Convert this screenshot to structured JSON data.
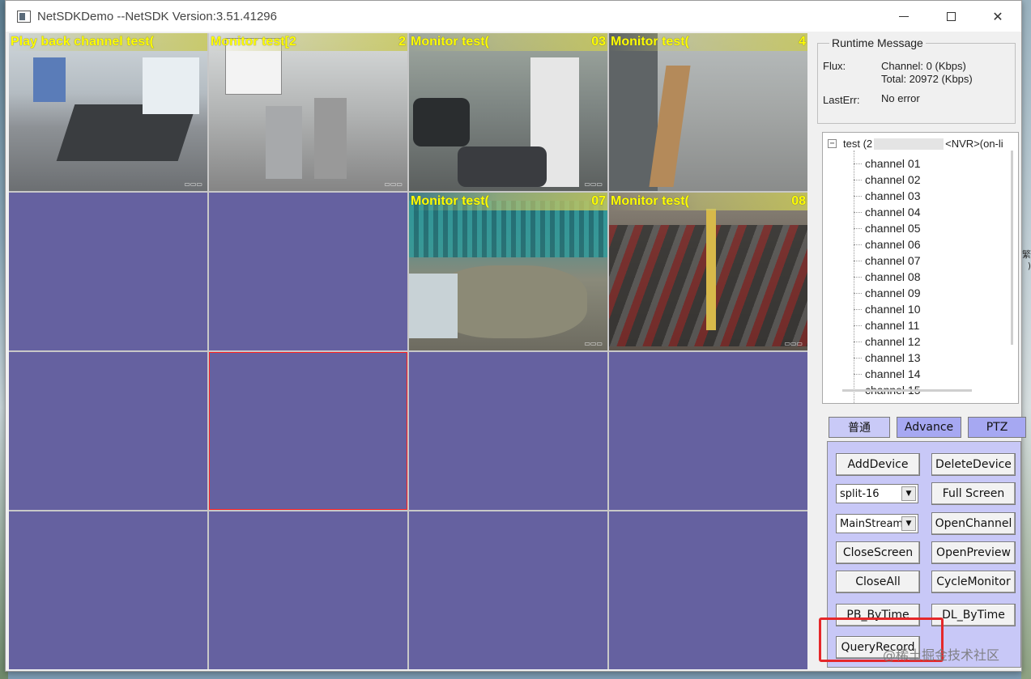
{
  "window": {
    "title": "NetSDKDemo  --NetSDK Version:3.51.41296",
    "minimize": "—",
    "close": "✕"
  },
  "video_cells": [
    {
      "label": "Play back channel test(",
      "num": "",
      "scene": "conference-room"
    },
    {
      "label": "Monitor test[2",
      "num": "2",
      "scene": "turnstile-gate"
    },
    {
      "label": "Monitor test(",
      "num": "03",
      "scene": "parking-lot"
    },
    {
      "label": "Monitor test(",
      "num": "4",
      "scene": "roadway"
    },
    {
      "label": "",
      "num": "",
      "scene": "empty"
    },
    {
      "label": "",
      "num": "",
      "scene": "empty"
    },
    {
      "label": "Monitor test(",
      "num": "07",
      "scene": "construction-site"
    },
    {
      "label": "Monitor test(",
      "num": "08",
      "scene": "bike-shed"
    }
  ],
  "runtime": {
    "group_title": "Runtime Message",
    "flux_label": "Flux:",
    "flux_channel": "Channel: 0 (Kbps)",
    "flux_total": "Total: 20972 (Kbps)",
    "lasterr_label": "LastErr:",
    "lasterr_value": "No error"
  },
  "tree": {
    "root_prefix": "test (2",
    "root_suffix": "<NVR>(on-li",
    "toggle": "−",
    "channels": [
      "channel 01",
      "channel 02",
      "channel 03",
      "channel 04",
      "channel 05",
      "channel 06",
      "channel 07",
      "channel 08",
      "channel 09",
      "channel 10",
      "channel 11",
      "channel 12",
      "channel 13",
      "channel 14",
      "channel 15"
    ]
  },
  "tabs": {
    "normal": "普通",
    "advance": "Advance",
    "ptz": "PTZ"
  },
  "buttons": {
    "add_device": "AddDevice",
    "delete_device": "DeleteDevice",
    "full_screen": "Full Screen",
    "open_channel": "OpenChannel",
    "close_screen": "CloseScreen",
    "open_preview": "OpenPreview",
    "close_all": "CloseAll",
    "cycle_monitor": "CycleMonitor",
    "pb_bytime": "PB_ByTime",
    "dl_bytime": "DL_ByTime",
    "query_record": "QueryRecord"
  },
  "combos": {
    "split": "split-16",
    "stream": "MainStream"
  },
  "watermark": "@稀土掘金技术社区",
  "desktop_glyph": "繁\n)",
  "colors": {
    "empty_cell": "#6561a0",
    "selected_border": "#ff2020",
    "overlay_text": "#ffff00",
    "tab_bg": "#a6a8f2",
    "button_area": "#c8c8f7",
    "highlight": "#e5282a"
  }
}
